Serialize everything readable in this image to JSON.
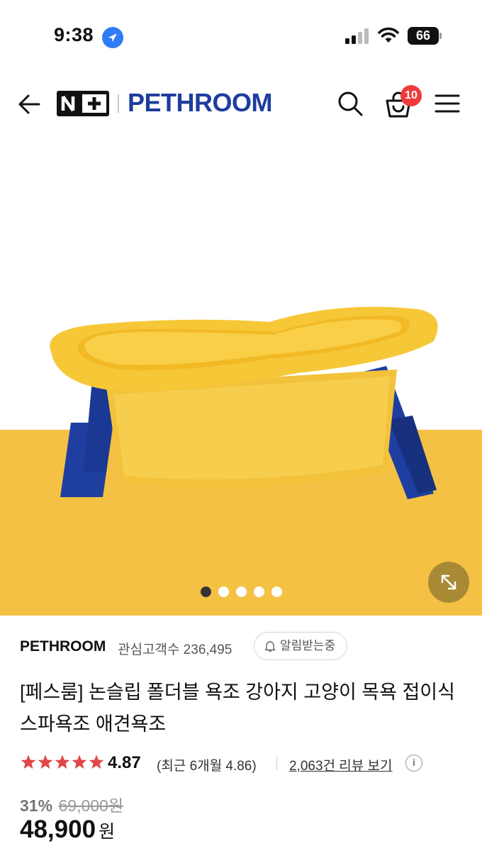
{
  "status_bar": {
    "time": "9:38",
    "battery": "66"
  },
  "header": {
    "logo_text": "N+",
    "brand": "PETHROOM",
    "cart_count": "10"
  },
  "gallery": {
    "image_count": 5,
    "active_index": 0,
    "colors": {
      "tub": "#f6c737",
      "legs": "#1e3fa0",
      "floor": "#f5c144"
    }
  },
  "product": {
    "seller": "PETHROOM",
    "follower_label": "관심고객수 236,495",
    "notify_label": "알림받는중",
    "title": "[페스룸] 논슬립 폴더블 욕조 강아지 고양이 목욕 접이식 스파욕조 애견욕조",
    "rating": "4.87",
    "rating_stars": 5,
    "recent_rating": "(최근 6개월 4.86)",
    "review_link": "2,063건 리뷰 보기",
    "discount": "31%",
    "original_price": "69,000원",
    "price": "48,900",
    "currency": "원"
  }
}
